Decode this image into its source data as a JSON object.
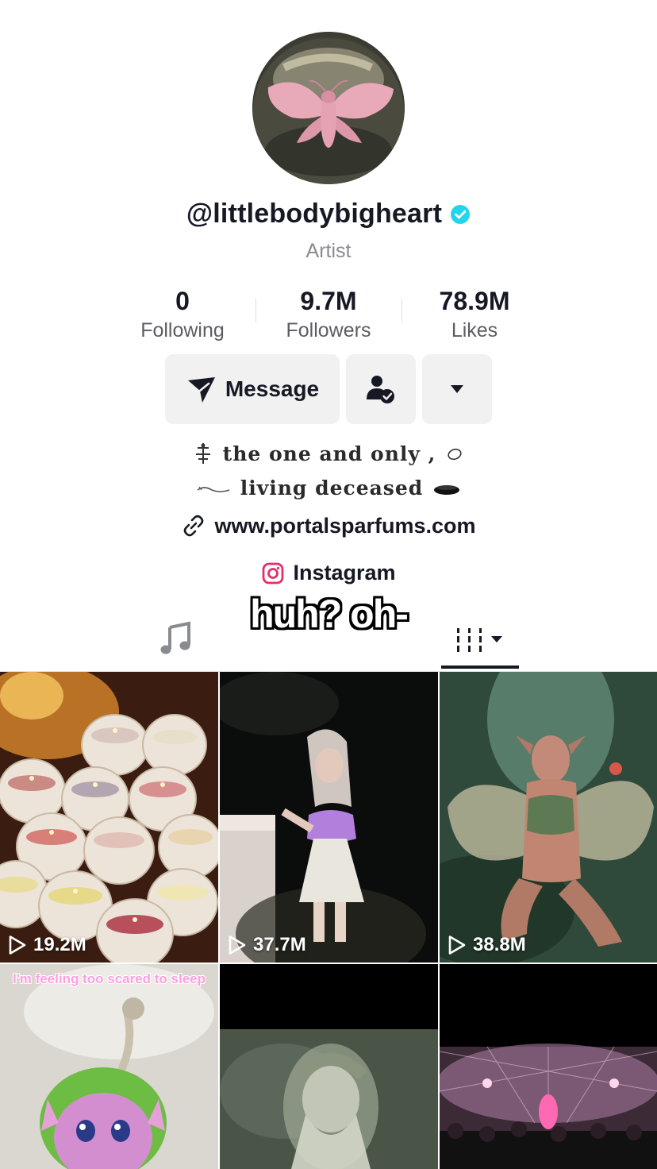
{
  "profile": {
    "username": "@littlebodybigheart",
    "verified": true,
    "category": "Artist",
    "accent": "#20D5EC"
  },
  "stats": [
    {
      "value": "0",
      "label": "Following"
    },
    {
      "value": "9.7M",
      "label": "Followers"
    },
    {
      "value": "78.9M",
      "label": "Likes"
    }
  ],
  "actions": {
    "message_label": "Message",
    "friend_icon": "user-check-icon",
    "more_icon": "caret-down-icon"
  },
  "bio": {
    "line1": "the one and only ,",
    "line2": "living deceased",
    "link": "www.portalsparfums.com",
    "instagram": "Instagram"
  },
  "overlay_caption": "huh? oh-",
  "tabs": {
    "music_icon": "music-note-icon",
    "videos_icon": "grid-bars-icon"
  },
  "videos": [
    {
      "views": "19.2M"
    },
    {
      "views": "37.7M"
    },
    {
      "views": "38.8M"
    },
    {
      "views": "",
      "caption": "I'm feeling too scared to sleep"
    },
    {
      "views": ""
    },
    {
      "views": ""
    }
  ]
}
